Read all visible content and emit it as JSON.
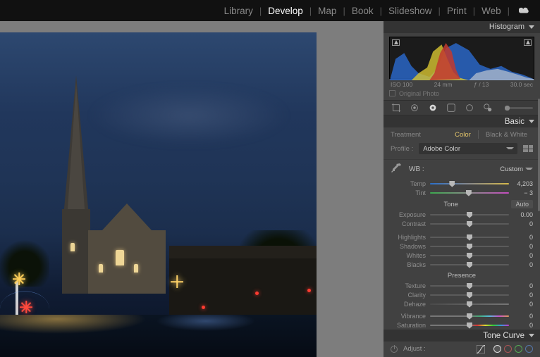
{
  "modules": {
    "library": "Library",
    "develop": "Develop",
    "map": "Map",
    "book": "Book",
    "slideshow": "Slideshow",
    "print": "Print",
    "web": "Web"
  },
  "panels": {
    "histogram": "Histogram",
    "basic": "Basic",
    "tonecurve": "Tone Curve"
  },
  "histogram": {
    "iso": "ISO 100",
    "focal": "24 mm",
    "aperture": "ƒ / 13",
    "shutter": "30.0 sec",
    "original": "Original Photo"
  },
  "basic": {
    "treatment_label": "Treatment",
    "treatment_color": "Color",
    "treatment_bw": "Black & White",
    "profile_label": "Profile :",
    "profile_value": "Adobe Color",
    "wb_label": "WB :",
    "wb_value": "Custom",
    "temp_label": "Temp",
    "temp_value": "4,203",
    "tint_label": "Tint",
    "tint_value": "− 3",
    "tone_header": "Tone",
    "auto": "Auto",
    "exposure_label": "Exposure",
    "exposure_value": "0.00",
    "contrast_label": "Contrast",
    "contrast_value": "0",
    "highlights_label": "Highlights",
    "highlights_value": "0",
    "shadows_label": "Shadows",
    "shadows_value": "0",
    "whites_label": "Whites",
    "whites_value": "0",
    "blacks_label": "Blacks",
    "blacks_value": "0",
    "presence_header": "Presence",
    "texture_label": "Texture",
    "texture_value": "0",
    "clarity_label": "Clarity",
    "clarity_value": "0",
    "dehaze_label": "Dehaze",
    "dehaze_value": "0",
    "vibrance_label": "Vibrance",
    "vibrance_value": "0",
    "saturation_label": "Saturation",
    "saturation_value": "0"
  },
  "tonecurve": {
    "adjust_label": "Adjust :"
  }
}
